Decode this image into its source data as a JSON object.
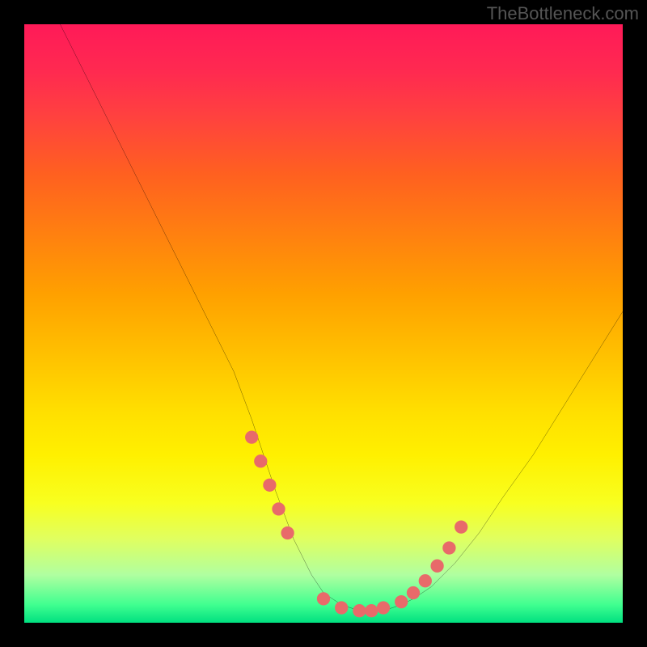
{
  "watermark": "TheBottleneck.com",
  "chart_data": {
    "type": "line",
    "title": "",
    "xlabel": "",
    "ylabel": "",
    "xlim": [
      0,
      100
    ],
    "ylim": [
      0,
      100
    ],
    "series": [
      {
        "name": "bottleneck-curve",
        "x": [
          6,
          10,
          15,
          20,
          25,
          30,
          35,
          38,
          40,
          42,
          45,
          48,
          50,
          53,
          56,
          60,
          63,
          65,
          68,
          72,
          76,
          80,
          85,
          90,
          95,
          100
        ],
        "y": [
          100,
          92,
          82,
          72,
          62,
          52,
          42,
          34,
          28,
          22,
          14,
          8,
          5,
          3,
          2,
          2,
          3,
          4,
          6,
          10,
          15,
          21,
          28,
          36,
          44,
          52
        ]
      }
    ],
    "markers": {
      "name": "highlight-dots",
      "color": "#e86a6a",
      "x": [
        38,
        39.5,
        41,
        42.5,
        44,
        50,
        53,
        56,
        58,
        60,
        63,
        65,
        67,
        69,
        71,
        73
      ],
      "y": [
        31,
        27,
        23,
        19,
        15,
        4,
        2.5,
        2,
        2,
        2.5,
        3.5,
        5,
        7,
        9.5,
        12.5,
        16
      ]
    },
    "background_gradient": {
      "top": "#ff1a58",
      "mid": "#ffe000",
      "bottom": "#00e080"
    }
  }
}
